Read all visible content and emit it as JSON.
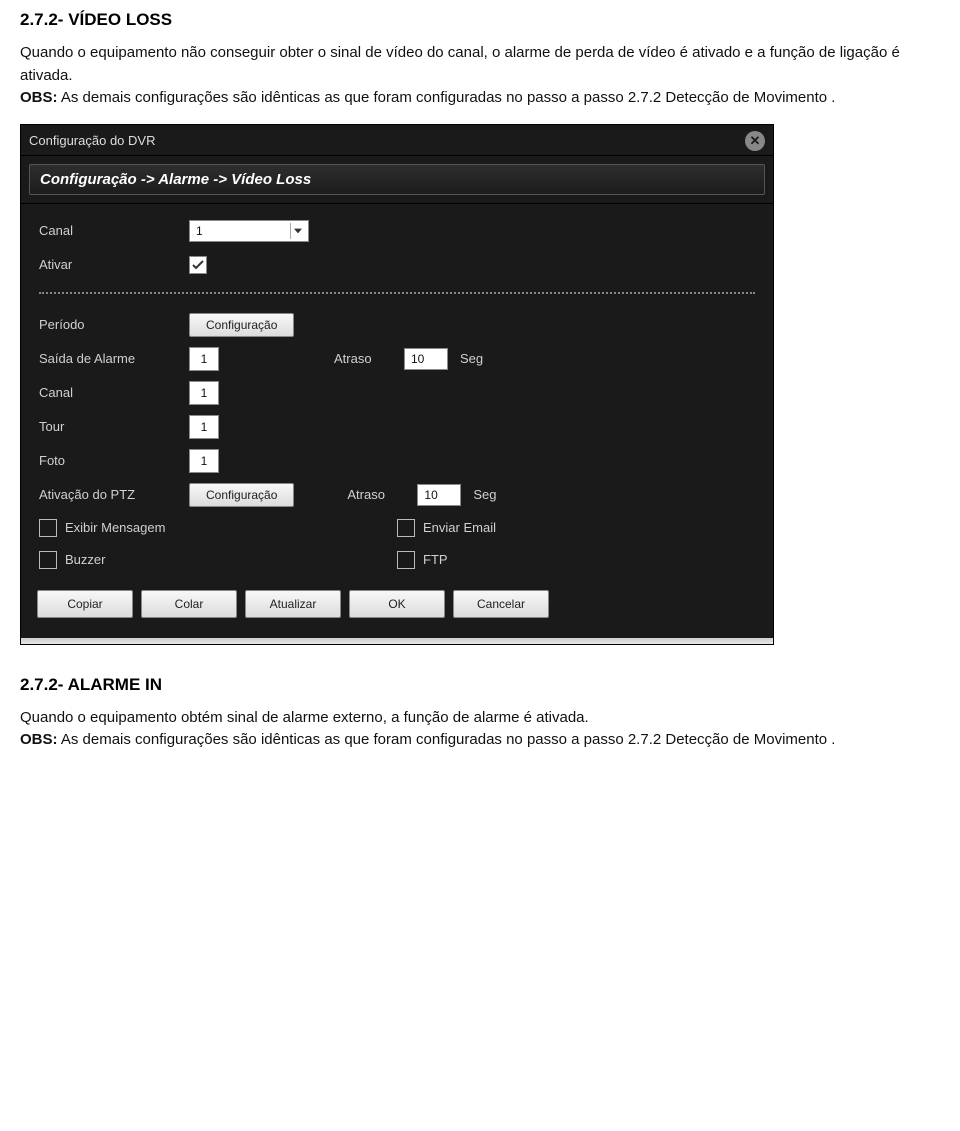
{
  "doc": {
    "section_272": {
      "title": "2.7.2- VÍDEO LOSS",
      "p1": "Quando o equipamento não conseguir obter o sinal de vídeo do canal, o alarme de perda de vídeo é ativado e a função de ligação é ativada.",
      "p2_bold": "OBS:",
      "p2_rest": " As demais configurações são idênticas as que foram configuradas no passo a passo 2.7.2 Detecção de Movimento ."
    },
    "section_272b": {
      "title": "2.7.2- ALARME IN",
      "p1": "Quando o equipamento obtém sinal de alarme externo, a função de alarme é ativada.",
      "p2_bold": "OBS:",
      "p2_rest": " As demais configurações são idênticas as que foram configuradas no passo a passo 2.7.2 Detecção de Movimento ."
    }
  },
  "window": {
    "title": "Configuração do DVR",
    "breadcrumb": "Configuração -> Alarme -> Vídeo Loss"
  },
  "form": {
    "canal_label": "Canal",
    "canal_value": "1",
    "ativar_label": "Ativar",
    "periodo_label": "Período",
    "config_button": "Configuração",
    "saida_alarme_label": "Saída de Alarme",
    "saida_alarme_value": "1",
    "atraso_label_1": "Atraso",
    "atraso_value_1": "10",
    "seg_unit": "Seg",
    "canal_rec_label": "Canal",
    "canal_rec_value": "1",
    "tour_label": "Tour",
    "tour_value": "1",
    "foto_label": "Foto",
    "foto_value": "1",
    "ptz_label": "Ativação do PTZ",
    "atraso_label_2": "Atraso",
    "atraso_value_2": "10",
    "exibir_msg_label": "Exibir Mensagem",
    "enviar_email_label": "Enviar Email",
    "buzzer_label": "Buzzer",
    "ftp_label": "FTP"
  },
  "buttons": {
    "copiar": "Copiar",
    "colar": "Colar",
    "atualizar": "Atualizar",
    "ok": "OK",
    "cancelar": "Cancelar"
  }
}
